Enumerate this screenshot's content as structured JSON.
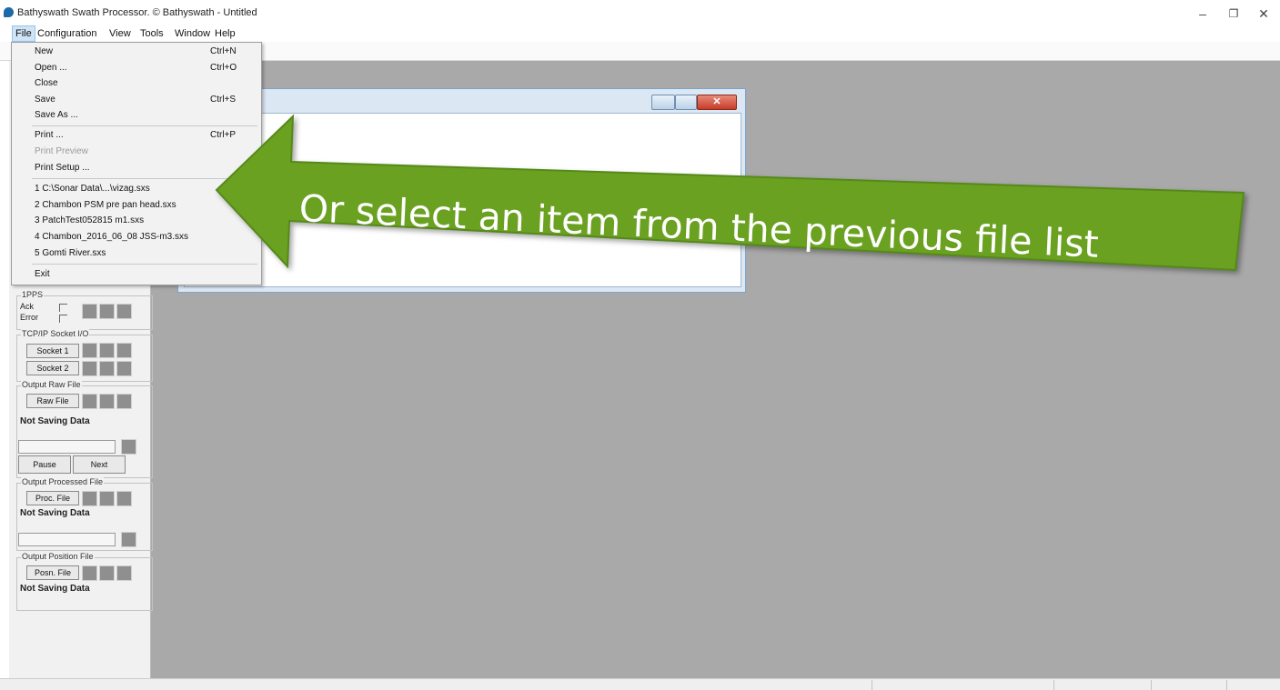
{
  "window": {
    "title": "Bathyswath Swath Processor.  © Bathyswath - Untitled",
    "controls": {
      "minimize": "–",
      "restore": "❐",
      "close": "✕"
    }
  },
  "menubar": {
    "items": [
      {
        "label": "File"
      },
      {
        "label": "Configuration"
      },
      {
        "label": "View"
      },
      {
        "label": "Tools"
      },
      {
        "label": "Window"
      },
      {
        "label": "Help"
      }
    ]
  },
  "file_menu": {
    "new": {
      "label": "New",
      "shortcut": "Ctrl+N"
    },
    "open": {
      "label": "Open ...",
      "shortcut": "Ctrl+O"
    },
    "close": {
      "label": "Close"
    },
    "save": {
      "label": "Save",
      "shortcut": "Ctrl+S"
    },
    "save_as": {
      "label": "Save As ..."
    },
    "print": {
      "label": "Print ...",
      "shortcut": "Ctrl+P"
    },
    "print_preview": {
      "label": "Print Preview"
    },
    "print_setup": {
      "label": "Print Setup ..."
    },
    "recent": [
      "1 C:\\Sonar Data\\...\\vizag.sxs",
      "2 Chambon PSM pre pan head.sxs",
      "3 PatchTest052815 m1.sxs",
      "4 Chambon_2016_06_08 JSS-m3.sxs",
      "5 Gomti River.sxs"
    ],
    "exit": {
      "label": "Exit"
    }
  },
  "annotation": {
    "text": "Or select an item from the previous file list",
    "color": "#6aa121"
  },
  "left_panel": {
    "pps": {
      "title": "1PPS",
      "ack": "Ack",
      "error": "Error"
    },
    "tcp": {
      "title": "TCP/IP Socket I/O",
      "socket1": "Socket 1",
      "socket2": "Socket 2"
    },
    "raw": {
      "title": "Output Raw File",
      "button": "Raw File",
      "status": "Not Saving Data",
      "pause": "Pause",
      "next": "Next"
    },
    "proc": {
      "title": "Output Processed File",
      "button": "Proc. File",
      "status": "Not Saving Data"
    },
    "posn": {
      "title": "Output Position File",
      "button": "Posn. File",
      "status": "Not Saving Data"
    }
  }
}
